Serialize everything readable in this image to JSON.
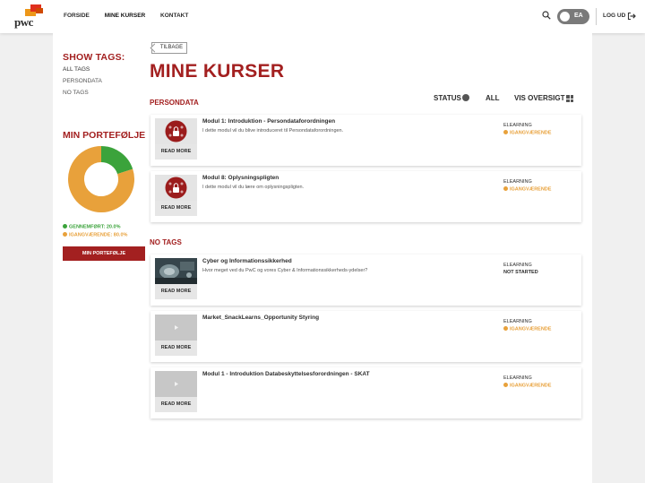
{
  "brand": {
    "logo_text": "pwc",
    "red": "#a32020",
    "orange": "#e8a13b",
    "green": "#3ba33b"
  },
  "header": {
    "nav": [
      "FORSIDE",
      "MINE KURSER",
      "KONTAKT"
    ],
    "user_initials": "EA",
    "logout": "LOG UD"
  },
  "sidebar": {
    "show_tags_title": "SHOW TAGS:",
    "tags": [
      "ALL TAGS",
      "PERSONDATA",
      "NO TAGS"
    ],
    "portfolio_title": "MIN PORTEFØLJE",
    "portfolio": {
      "completed_label": "GENNEMFØRT: 20.0%",
      "completed_value": 20.0,
      "in_progress_label": "IGANGVÆRENDE: 80.0%",
      "in_progress_value": 80.0
    },
    "portfolio_button": "MIN PORTEFØLJE"
  },
  "main": {
    "back": "TILBAGE",
    "title": "MINE KURSER",
    "filters": {
      "status": "STATUS",
      "all": "ALL",
      "overview": "VIS OVERSIGT"
    },
    "read_more": "READ MORE",
    "sections": [
      {
        "title": "PERSONDATA",
        "courses": [
          {
            "title": "Modul 1: Introduktion - Persondataforordningen",
            "desc": "I dette modul vil du blive introduceret til Persondataforordningen.",
            "type": "ELEARNING",
            "status": "IGANGVÆRENDE",
            "thumb": "lock-icon"
          },
          {
            "title": "Modul 8: Oplysningspligten",
            "desc": "I dette modul vil du lære om oplysningspligten.",
            "type": "ELEARNING",
            "status": "IGANGVÆRENDE",
            "thumb": "lock-icon"
          }
        ]
      },
      {
        "title": "NO TAGS",
        "courses": [
          {
            "title": "Cyber og Informationssikkerhed",
            "desc": "Hvor meget ved du PwC og vores Cyber & Informationssikkerheds-ydelser?",
            "type": "ELEARNING",
            "status": "NOT STARTED",
            "thumb": "photo"
          },
          {
            "title": "Market_SnackLearns_Opportunity Styring",
            "desc": "",
            "type": "ELEARNING",
            "status": "IGANGVÆRENDE",
            "thumb": "play-icon"
          },
          {
            "title": "Modul 1 - Introduktion Databeskyttelsesforordningen - SKAT",
            "desc": "",
            "type": "ELEARNING",
            "status": "IGANGVÆRENDE",
            "thumb": "play-icon"
          }
        ]
      }
    ]
  }
}
